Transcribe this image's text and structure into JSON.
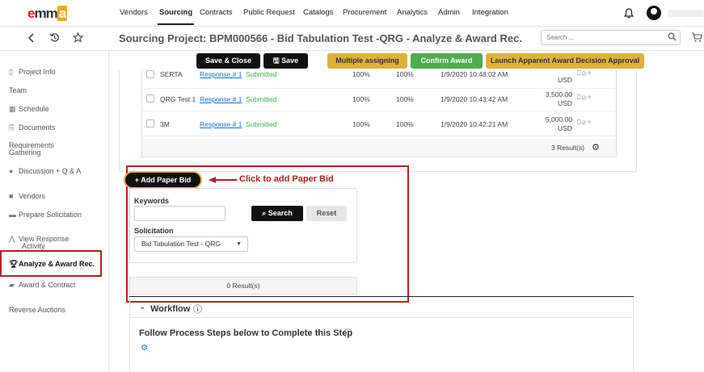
{
  "app": {
    "logo_text": "emma",
    "nav": [
      "Vendors",
      "Sourcing",
      "Contracts",
      "Public Request",
      "Catalogs",
      "Procurement",
      "Analytics",
      "Admin",
      "Integration"
    ],
    "active_nav": "Sourcing"
  },
  "header": {
    "title": "Sourcing Project: BPM000566 - Bid Tabulation Test -QRG - Analyze & Award Rec.",
    "search_placeholder": "Search ..."
  },
  "sidebar": {
    "items": [
      {
        "label": "Project Info",
        "icon": "clipboard-icon"
      },
      {
        "label": "Team",
        "icon": ""
      },
      {
        "label": "Schedule",
        "icon": "calendar-icon"
      },
      {
        "label": "Documents",
        "icon": "document-icon"
      },
      {
        "label": "Requirements Gathering",
        "icon": ""
      },
      {
        "label": "Discussion + Q & A",
        "icon": "chat-icon"
      },
      {
        "label": "Vendors",
        "icon": "truck-icon"
      },
      {
        "label": "Prepare Solicitation",
        "icon": "folder-icon"
      },
      {
        "label": "View Response Activity",
        "icon": "chart-icon"
      },
      {
        "label": "Analyze & Award Rec.",
        "icon": "trophy-icon"
      },
      {
        "label": "Award & Contract",
        "icon": "handshake-icon"
      },
      {
        "label": "Reverse Auctions",
        "icon": ""
      }
    ],
    "active": "Analyze & Award Rec."
  },
  "actions": {
    "save_close": "Save & Close",
    "save": "Save",
    "multiple_assigning": "Multiple assigning",
    "confirm_award": "Confirm Award",
    "launch": "Launch Apparent Award Decision Approval"
  },
  "responses": {
    "rows": [
      {
        "vendor": "SERTA",
        "response": "Response # 1",
        "status": "Submitted",
        "pct1": "100%",
        "pct2": "100%",
        "date": "1/9/2020 10:48:02 AM",
        "amount": "",
        "currency": "USD"
      },
      {
        "vendor": "QRG Test 1",
        "response": "Response # 1",
        "status": "Submitted",
        "pct1": "100%",
        "pct2": "100%",
        "date": "1/9/2020 10:43:42 AM",
        "amount": "3,500.00",
        "currency": "USD"
      },
      {
        "vendor": "3M",
        "response": "Response # 1",
        "status": "Submitted",
        "pct1": "100%",
        "pct2": "100%",
        "date": "1/9/2020 10:42:21 AM",
        "amount": "5,000.00",
        "currency": "USD"
      }
    ],
    "result_count": "3 Result(s)"
  },
  "paper_bid": {
    "add_label": "+ Add Paper Bid",
    "annotation": "Click to add Paper Bid",
    "keywords_label": "Keywords",
    "search_label": "Search",
    "reset_label": "Reset",
    "solicitation_label": "Solicitation",
    "solicitation_value": "Bid Tabulation Test - QRG",
    "result_count": "0 Result(s)"
  },
  "workflow": {
    "title": "Workflow",
    "subtitle": "Follow Process Steps below to Complete this Step"
  },
  "colors": {
    "accent_gold": "#e0b13b",
    "accent_green": "#4cae4c",
    "highlight_red": "#b22222",
    "link_blue": "#1a73c8"
  }
}
